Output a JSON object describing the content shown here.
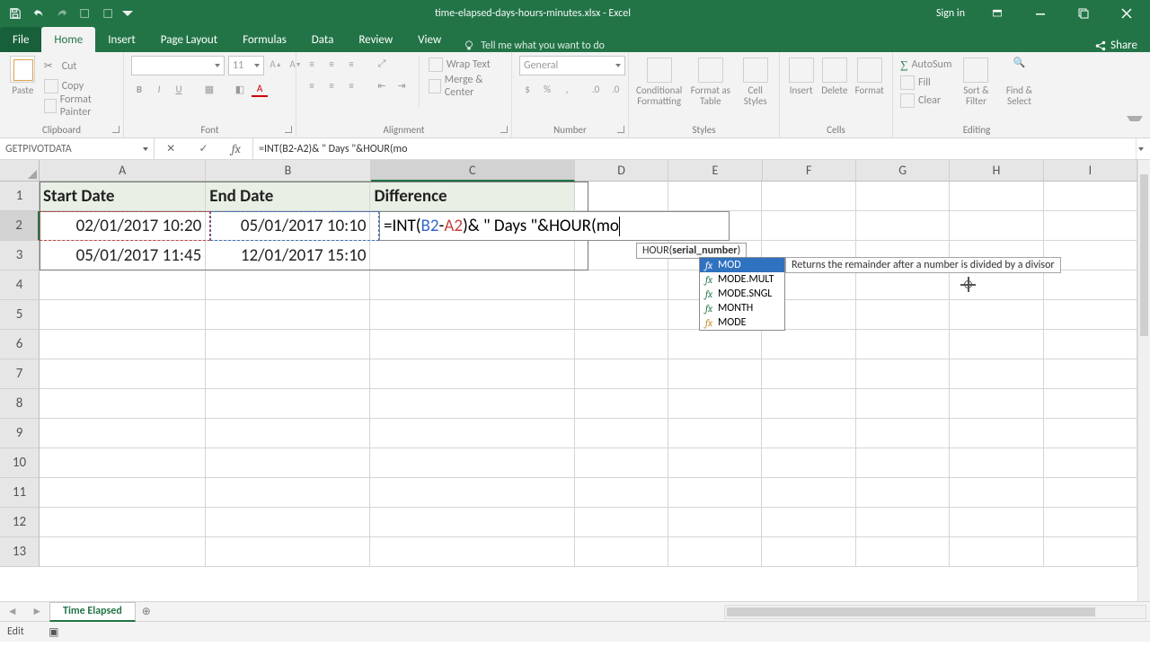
{
  "app": {
    "title": "time-elapsed-days-hours-minutes.xlsx - Excel",
    "signin": "Sign in"
  },
  "tabs": {
    "file": "File",
    "home": "Home",
    "insert": "Insert",
    "pagelayout": "Page Layout",
    "formulas": "Formulas",
    "data": "Data",
    "review": "Review",
    "view": "View",
    "tellme": "Tell me what you want to do",
    "share": "Share"
  },
  "ribbon": {
    "clipboard": {
      "label": "Clipboard",
      "paste": "Paste",
      "cut": "Cut",
      "copy": "Copy",
      "formatpainter": "Format Painter"
    },
    "font": {
      "label": "Font",
      "family": "",
      "size": "11",
      "bold": "B",
      "italic": "I",
      "underline": "U"
    },
    "alignment": {
      "label": "Alignment",
      "wrap": "Wrap Text",
      "merge": "Merge & Center"
    },
    "number": {
      "label": "Number",
      "format": "General"
    },
    "styles": {
      "label": "Styles",
      "cond": "Conditional Formatting",
      "table": "Format as Table",
      "cell": "Cell Styles"
    },
    "cells": {
      "label": "Cells",
      "insert": "Insert",
      "delete": "Delete",
      "format": "Format"
    },
    "editing": {
      "label": "Editing",
      "autosum": "AutoSum",
      "fill": "Fill",
      "clear": "Clear",
      "sort": "Sort & Filter",
      "find": "Find & Select"
    }
  },
  "namebox": "GETPIVOTDATA",
  "formula": "=INT(B2-A2)& \" Days \"&HOUR(mo",
  "columns": [
    "A",
    "B",
    "C",
    "D",
    "E",
    "F",
    "G",
    "H",
    "I"
  ],
  "rows": [
    "1",
    "2",
    "3",
    "4",
    "5",
    "6",
    "7",
    "8",
    "9",
    "10",
    "11",
    "12",
    "13"
  ],
  "sheet": {
    "headers": {
      "A": "Start Date",
      "B": "End Date",
      "C": "Difference"
    },
    "r2": {
      "A": "02/01/2017 10:20",
      "B": "05/01/2017 10:10"
    },
    "r3": {
      "A": "05/01/2017 11:45",
      "B": "12/01/2017 15:10"
    },
    "edit": {
      "p1": "=INT(",
      "b2": "B2",
      "dash": "-",
      "a2": "A2",
      "p2": ")& \" Days \"&HOUR(mo"
    }
  },
  "tooltip": {
    "fname": "HOUR(",
    "arg": "serial_number",
    "close": ")"
  },
  "autocomplete": {
    "items": [
      "MOD",
      "MODE.MULT",
      "MODE.SNGL",
      "MONTH",
      "MODE"
    ],
    "desc": "Returns the remainder after a number is divided by a divisor"
  },
  "sheetbar": {
    "tab": "Time Elapsed"
  },
  "status": {
    "mode": "Edit"
  }
}
